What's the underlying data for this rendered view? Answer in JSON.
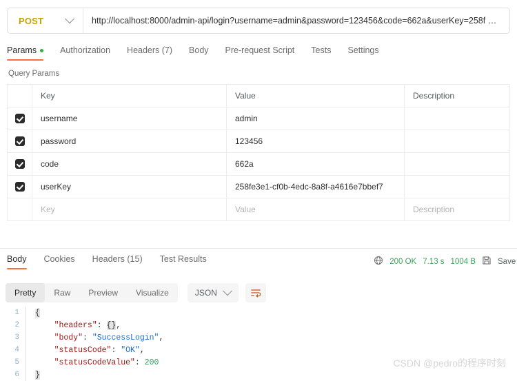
{
  "request": {
    "method": "POST",
    "url": "http://localhost:8000/admin-api/login?username=admin&password=123456&code=662a&userKey=258f …",
    "tabs": [
      {
        "label": "Params",
        "active": true,
        "dot": true
      },
      {
        "label": "Authorization",
        "active": false,
        "dot": false
      },
      {
        "label": "Headers (7)",
        "active": false,
        "dot": false
      },
      {
        "label": "Body",
        "active": false,
        "dot": false
      },
      {
        "label": "Pre-request Script",
        "active": false,
        "dot": false
      },
      {
        "label": "Tests",
        "active": false,
        "dot": false
      },
      {
        "label": "Settings",
        "active": false,
        "dot": false
      }
    ]
  },
  "query_params": {
    "title": "Query Params",
    "columns": {
      "key": "Key",
      "value": "Value",
      "description": "Description"
    },
    "rows": [
      {
        "checked": true,
        "key": "username",
        "value": "admin",
        "description": ""
      },
      {
        "checked": true,
        "key": "password",
        "value": "123456",
        "description": ""
      },
      {
        "checked": true,
        "key": "code",
        "value": "662a",
        "description": ""
      },
      {
        "checked": true,
        "key": "userKey",
        "value": "258fe3e1-cf0b-4edc-8a8f-a4616e7bbef7",
        "description": ""
      }
    ],
    "placeholder_row": {
      "key": "Key",
      "value": "Value",
      "description": "Description"
    }
  },
  "response": {
    "tabs": [
      {
        "label": "Body",
        "active": true
      },
      {
        "label": "Cookies",
        "active": false
      },
      {
        "label": "Headers (15)",
        "active": false
      },
      {
        "label": "Test Results",
        "active": false
      }
    ],
    "status": "200 OK",
    "time": "7.13 s",
    "size": "1004 B",
    "save_label": "Save",
    "toolbar": {
      "formats": [
        {
          "label": "Pretty",
          "active": true
        },
        {
          "label": "Raw",
          "active": false
        },
        {
          "label": "Preview",
          "active": false
        },
        {
          "label": "Visualize",
          "active": false
        }
      ],
      "language": "JSON"
    },
    "body_lines": [
      {
        "num": "1",
        "tokens": [
          {
            "t": "{",
            "c": "tk-brace"
          }
        ]
      },
      {
        "num": "2",
        "tokens": [
          {
            "t": "    ",
            "c": "tk-punc"
          },
          {
            "t": "\"headers\"",
            "c": "tk-key"
          },
          {
            "t": ": ",
            "c": "tk-punc"
          },
          {
            "t": "{}",
            "c": "tk-brace"
          },
          {
            "t": ",",
            "c": "tk-punc"
          }
        ]
      },
      {
        "num": "3",
        "tokens": [
          {
            "t": "    ",
            "c": "tk-punc"
          },
          {
            "t": "\"body\"",
            "c": "tk-key"
          },
          {
            "t": ": ",
            "c": "tk-punc"
          },
          {
            "t": "\"SuccessLogin\"",
            "c": "tk-str"
          },
          {
            "t": ",",
            "c": "tk-punc"
          }
        ]
      },
      {
        "num": "4",
        "tokens": [
          {
            "t": "    ",
            "c": "tk-punc"
          },
          {
            "t": "\"statusCode\"",
            "c": "tk-key"
          },
          {
            "t": ": ",
            "c": "tk-punc"
          },
          {
            "t": "\"OK\"",
            "c": "tk-str"
          },
          {
            "t": ",",
            "c": "tk-punc"
          }
        ]
      },
      {
        "num": "5",
        "tokens": [
          {
            "t": "    ",
            "c": "tk-punc"
          },
          {
            "t": "\"statusCodeValue\"",
            "c": "tk-key"
          },
          {
            "t": ": ",
            "c": "tk-punc"
          },
          {
            "t": "200",
            "c": "tk-num"
          }
        ]
      },
      {
        "num": "6",
        "tokens": [
          {
            "t": "}",
            "c": "tk-brace"
          }
        ]
      }
    ]
  },
  "watermark": "CSDN @pedro的程序时刻",
  "colors": {
    "accent": "#ff6c37",
    "method": "#c8a200",
    "status_green": "#3aa45b",
    "dot_green": "#2fb344"
  }
}
